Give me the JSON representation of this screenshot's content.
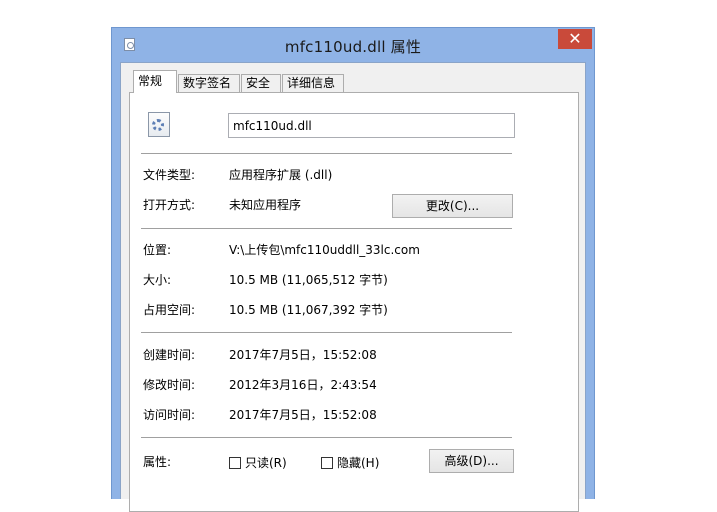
{
  "window": {
    "title": "mfc110ud.dll 属性",
    "close_glyph": "✕"
  },
  "tabs": [
    {
      "label": "常规",
      "active": true
    },
    {
      "label": "数字签名",
      "active": false
    },
    {
      "label": "安全",
      "active": false
    },
    {
      "label": "详细信息",
      "active": false
    }
  ],
  "file": {
    "icon": "dll-file-gear-icon",
    "name": "mfc110ud.dll"
  },
  "info": {
    "type_label": "文件类型:",
    "type_value": "应用程序扩展 (.dll)",
    "opens_with_label": "打开方式:",
    "opens_with_value": "未知应用程序",
    "change_button": "更改(C)...",
    "location_label": "位置:",
    "location_value": "V:\\上传包\\mfc110uddll_33lc.com",
    "size_label": "大小:",
    "size_value": "10.5 MB (11,065,512 字节)",
    "disk_size_label": "占用空间:",
    "disk_size_value": "10.5 MB (11,067,392 字节)",
    "created_label": "创建时间:",
    "created_value": "2017年7月5日，15:52:08",
    "modified_label": "修改时间:",
    "modified_value": "2012年3月16日，2:43:54",
    "accessed_label": "访问时间:",
    "accessed_value": "2017年7月5日，15:52:08",
    "attributes_label": "属性:",
    "readonly_label": "只读(R)",
    "readonly_checked": false,
    "hidden_label": "隐藏(H)",
    "hidden_checked": false,
    "advanced_button": "高级(D)..."
  }
}
